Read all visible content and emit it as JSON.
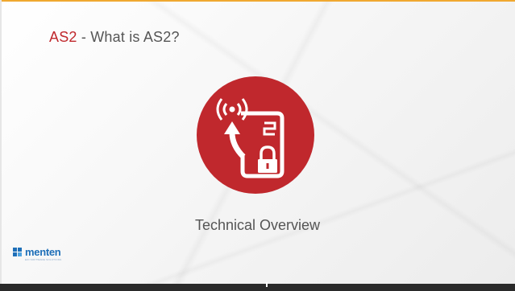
{
  "slide": {
    "title_prefix": "AS2",
    "title_rest": " - What is AS2?",
    "subtitle": "Technical Overview",
    "emblem_icon": "secure-transmission-icon",
    "logo_text": "menten",
    "logo_tagline": "EDI SOFTWARE SOLUTIONS"
  },
  "colors": {
    "accent": "#c0282d",
    "top_rule": "#f0a830",
    "brand_blue": "#1e6fb8",
    "text": "#555555",
    "bottom_bar": "#2a2a2a"
  }
}
